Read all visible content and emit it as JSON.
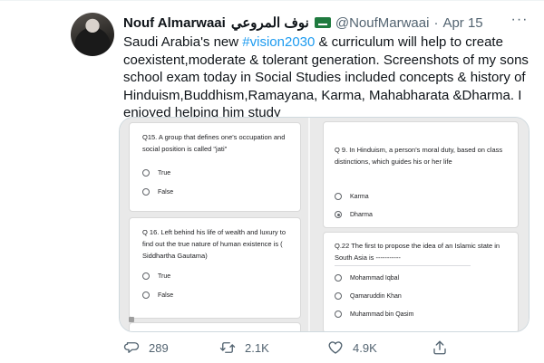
{
  "tweet": {
    "author_name": "Nouf Almarwaai",
    "author_name_ar": "نوف المروعي",
    "handle": "@NoufMarwaai",
    "separator": "·",
    "date": "Apr 15",
    "more_label": "···",
    "text_before": "Saudi Arabia's new ",
    "hashtag": "#vision2030",
    "text_after": " & curriculum will help to create coexistent,moderate & tolerant generation. Screenshots of my sons school exam today in Social Studies included concepts & history of Hinduism,Buddhism,Ramayana, Karma, Mahabharata &Dharma. I enjoyed helping him study"
  },
  "media": {
    "left": [
      {
        "question": "Q15. A group that defines one's occupation and social position is called \"jati\"",
        "options": [
          {
            "label": "True",
            "checked": false
          },
          {
            "label": "False",
            "checked": false
          }
        ]
      },
      {
        "question": "Q 16. Left behind his life of wealth and luxury to find out the true nature of human existence is ( Siddhartha Gautama)",
        "options": [
          {
            "label": "True",
            "checked": false
          },
          {
            "label": "False",
            "checked": false
          }
        ]
      }
    ],
    "right": [
      {
        "question": "Q 9. In Hinduism, a person's moral duty, based on class distinctions, which guides his or her life",
        "options": [
          {
            "label": "Karma",
            "checked": false
          },
          {
            "label": "Dharma",
            "checked": true
          }
        ]
      },
      {
        "question": "Q.22 The first to propose the idea of an Islamic state in South Asia is -----------",
        "options": [
          {
            "label": "Mohammad Iqbal",
            "checked": false
          },
          {
            "label": "Qamaruddin Khan",
            "checked": false
          },
          {
            "label": "Muhammad bin Qasim",
            "checked": false
          }
        ]
      }
    ]
  },
  "actions": {
    "replies": "289",
    "retweets": "2.1K",
    "likes": "4.9K"
  },
  "colors": {
    "accent": "#1d9bf0",
    "muted": "#536471",
    "text": "#0f1419"
  }
}
